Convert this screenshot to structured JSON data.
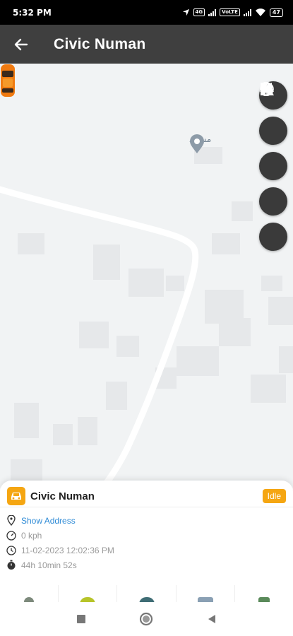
{
  "status_bar": {
    "time": "5:32 PM",
    "sim_label_1": "4G",
    "sim_label_2": "VoLTE",
    "battery": "47"
  },
  "app_bar": {
    "title": "Civic Numan",
    "back_icon": "arrow-left-icon"
  },
  "map": {
    "poi_label": "مسجد",
    "controls": [
      {
        "name": "map-type-icon"
      },
      {
        "name": "traffic-icon"
      },
      {
        "name": "street-view-icon"
      },
      {
        "name": "terrain-icon"
      },
      {
        "name": "grid-icon"
      }
    ]
  },
  "sheet": {
    "vehicle_name": "Civic Numan",
    "status": "Idle",
    "address_link": "Show Address",
    "speed": "0 kph",
    "datetime": "11-02-2023 12:02:36 PM",
    "duration": "44h 10min 52s"
  },
  "colors": {
    "accent": "#f5a612",
    "app_bar": "#3f3f3f",
    "link": "#2f8bd6"
  }
}
